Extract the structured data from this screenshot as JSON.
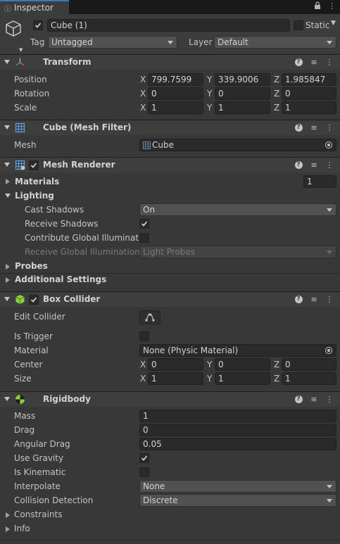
{
  "window": {
    "tab_title": "Inspector",
    "lock_icon": "lock-icon",
    "menu_icon": "kebab-menu-icon"
  },
  "object": {
    "name": "Cube (1)",
    "active": true,
    "static_label": "Static",
    "tag_label": "Tag",
    "tag_value": "Untagged",
    "layer_label": "Layer",
    "layer_value": "Default"
  },
  "transform": {
    "title": "Transform",
    "position": {
      "label": "Position",
      "x": "799.7599",
      "y": "339.9006",
      "z": "1.985847"
    },
    "rotation": {
      "label": "Rotation",
      "x": "0",
      "y": "0",
      "z": "0"
    },
    "scale": {
      "label": "Scale",
      "x": "1",
      "y": "1",
      "z": "1"
    }
  },
  "axes": {
    "x": "X",
    "y": "Y",
    "z": "Z"
  },
  "mesh_filter": {
    "title": "Cube (Mesh Filter)",
    "mesh_label": "Mesh",
    "mesh_value": "Cube"
  },
  "mesh_renderer": {
    "title": "Mesh Renderer",
    "enabled": true,
    "materials_label": "Materials",
    "materials_count": "1",
    "lighting_label": "Lighting",
    "cast_shadows_label": "Cast Shadows",
    "cast_shadows_value": "On",
    "receive_shadows_label": "Receive Shadows",
    "receive_shadows": true,
    "contribute_gi_label": "Contribute Global Illumination",
    "contribute_gi": false,
    "receive_gi_label": "Receive Global Illumination",
    "receive_gi_value": "Light Probes",
    "probes_label": "Probes",
    "additional_settings_label": "Additional Settings"
  },
  "box_collider": {
    "title": "Box Collider",
    "enabled": true,
    "edit_collider_label": "Edit Collider",
    "is_trigger_label": "Is Trigger",
    "is_trigger": false,
    "material_label": "Material",
    "material_value": "None (Physic Material)",
    "center": {
      "label": "Center",
      "x": "0",
      "y": "0",
      "z": "0"
    },
    "size": {
      "label": "Size",
      "x": "1",
      "y": "1",
      "z": "1"
    }
  },
  "rigidbody": {
    "title": "Rigidbody",
    "mass_label": "Mass",
    "mass": "1",
    "drag_label": "Drag",
    "drag": "0",
    "angular_drag_label": "Angular Drag",
    "angular_drag": "0.05",
    "use_gravity_label": "Use Gravity",
    "use_gravity": true,
    "is_kinematic_label": "Is Kinematic",
    "is_kinematic": false,
    "interpolate_label": "Interpolate",
    "interpolate": "None",
    "collision_detection_label": "Collision Detection",
    "collision_detection": "Discrete",
    "constraints_label": "Constraints",
    "info_label": "Info"
  },
  "colors": {
    "background": "#383838",
    "header": "#3e3e3e",
    "field": "#2a2a2a",
    "accent": "#3a79bb"
  }
}
